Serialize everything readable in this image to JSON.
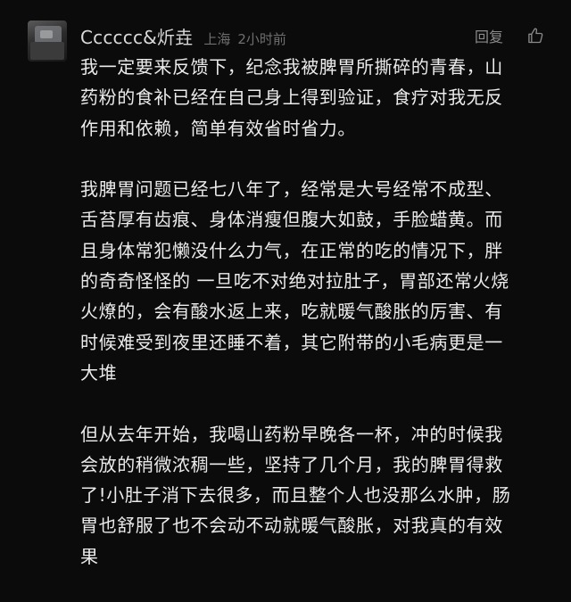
{
  "comment": {
    "username": "Cccccc&炘垚",
    "location": "上海",
    "time": "2小时前",
    "reply_label": "回复",
    "like_icon": "thumbs-up-icon",
    "paragraphs": [
      "我一定要来反馈下，纪念我被脾胃所撕碎的青春，山\n药粉的食补已经在自己身上得到验证，食疗对我无反\n作用和依赖，简单有效省时省力。",
      "我脾胃问题已经七八年了，经常是大号经常不成型、\n舌苔厚有齿痕、身体消瘦但腹大如鼓，手脸蜡黄。而\n且身体常犯懒没什么力气，在正常的吃的情况下，胖\n的奇奇怪怪的 一旦吃不对绝对拉肚子，胃部还常火烧\n火燎的，会有酸水返上来，吃就暖气酸胀的厉害、有\n时候难受到夜里还睡不着，其它附带的小毛病更是一\n大堆",
      "但从去年开始，我喝山药粉早晚各一杯，冲的时候我\n会放的稍微浓稠一些，坚持了几个月，我的脾胃得救\n了!小肚子消下去很多，而且整个人也没那么水肿，肠\n胃也舒服了也不会动不动就暖气酸胀，对我真的有效\n果"
    ]
  },
  "colors": {
    "background": "#0b0b0b",
    "username": "#d9d9d9",
    "meta": "#6f6f6f",
    "text": "#ebebeb",
    "action": "#8a8a8a"
  }
}
